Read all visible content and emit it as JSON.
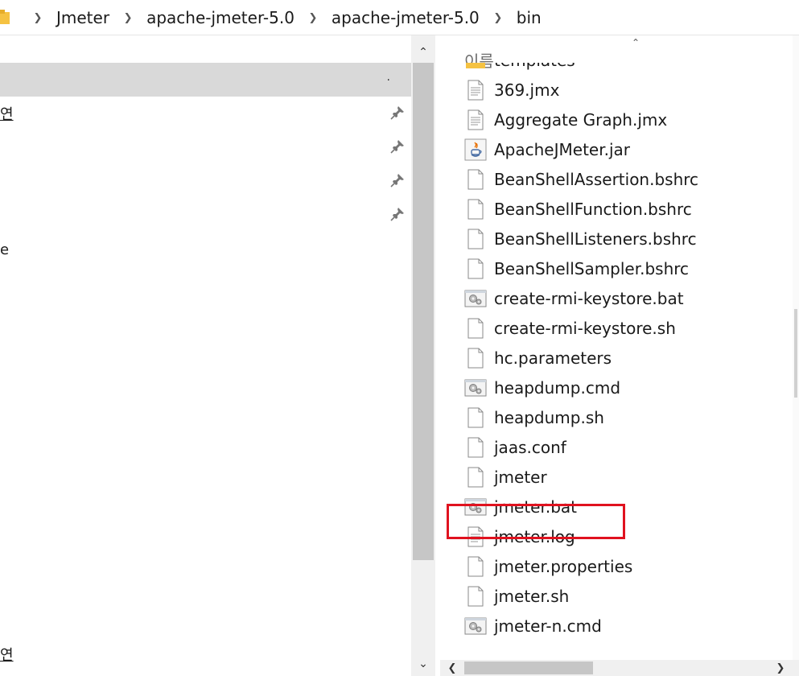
{
  "breadcrumb": {
    "items": [
      "Jmeter",
      "apache-jmeter-5.0",
      "apache-jmeter-5.0",
      "bin"
    ]
  },
  "left_pane": {
    "selected_dot": ".",
    "edge_labels": [
      "연",
      "e",
      "연"
    ]
  },
  "file_list": {
    "column_name": "이름",
    "items": [
      {
        "name": "templates",
        "icon": "folder-icon"
      },
      {
        "name": "369.jmx",
        "icon": "text-file-icon"
      },
      {
        "name": "Aggregate Graph.jmx",
        "icon": "text-file-icon"
      },
      {
        "name": "ApacheJMeter.jar",
        "icon": "java-jar-icon"
      },
      {
        "name": "BeanShellAssertion.bshrc",
        "icon": "blank-file-icon"
      },
      {
        "name": "BeanShellFunction.bshrc",
        "icon": "blank-file-icon"
      },
      {
        "name": "BeanShellListeners.bshrc",
        "icon": "blank-file-icon"
      },
      {
        "name": "BeanShellSampler.bshrc",
        "icon": "blank-file-icon"
      },
      {
        "name": "create-rmi-keystore.bat",
        "icon": "batch-file-icon"
      },
      {
        "name": "create-rmi-keystore.sh",
        "icon": "blank-file-icon"
      },
      {
        "name": "hc.parameters",
        "icon": "blank-file-icon"
      },
      {
        "name": "heapdump.cmd",
        "icon": "batch-file-icon"
      },
      {
        "name": "heapdump.sh",
        "icon": "blank-file-icon"
      },
      {
        "name": "jaas.conf",
        "icon": "blank-file-icon"
      },
      {
        "name": "jmeter",
        "icon": "blank-file-icon"
      },
      {
        "name": "jmeter.bat",
        "icon": "batch-file-icon",
        "highlighted": true
      },
      {
        "name": "jmeter.log",
        "icon": "text-file-icon"
      },
      {
        "name": "jmeter.properties",
        "icon": "blank-file-icon"
      },
      {
        "name": "jmeter.sh",
        "icon": "blank-file-icon"
      },
      {
        "name": "jmeter-n.cmd",
        "icon": "batch-file-icon"
      }
    ]
  },
  "colors": {
    "highlight_border": "#e0121f",
    "selection_bg": "#d9d9d9",
    "folder": "#f5c242"
  }
}
